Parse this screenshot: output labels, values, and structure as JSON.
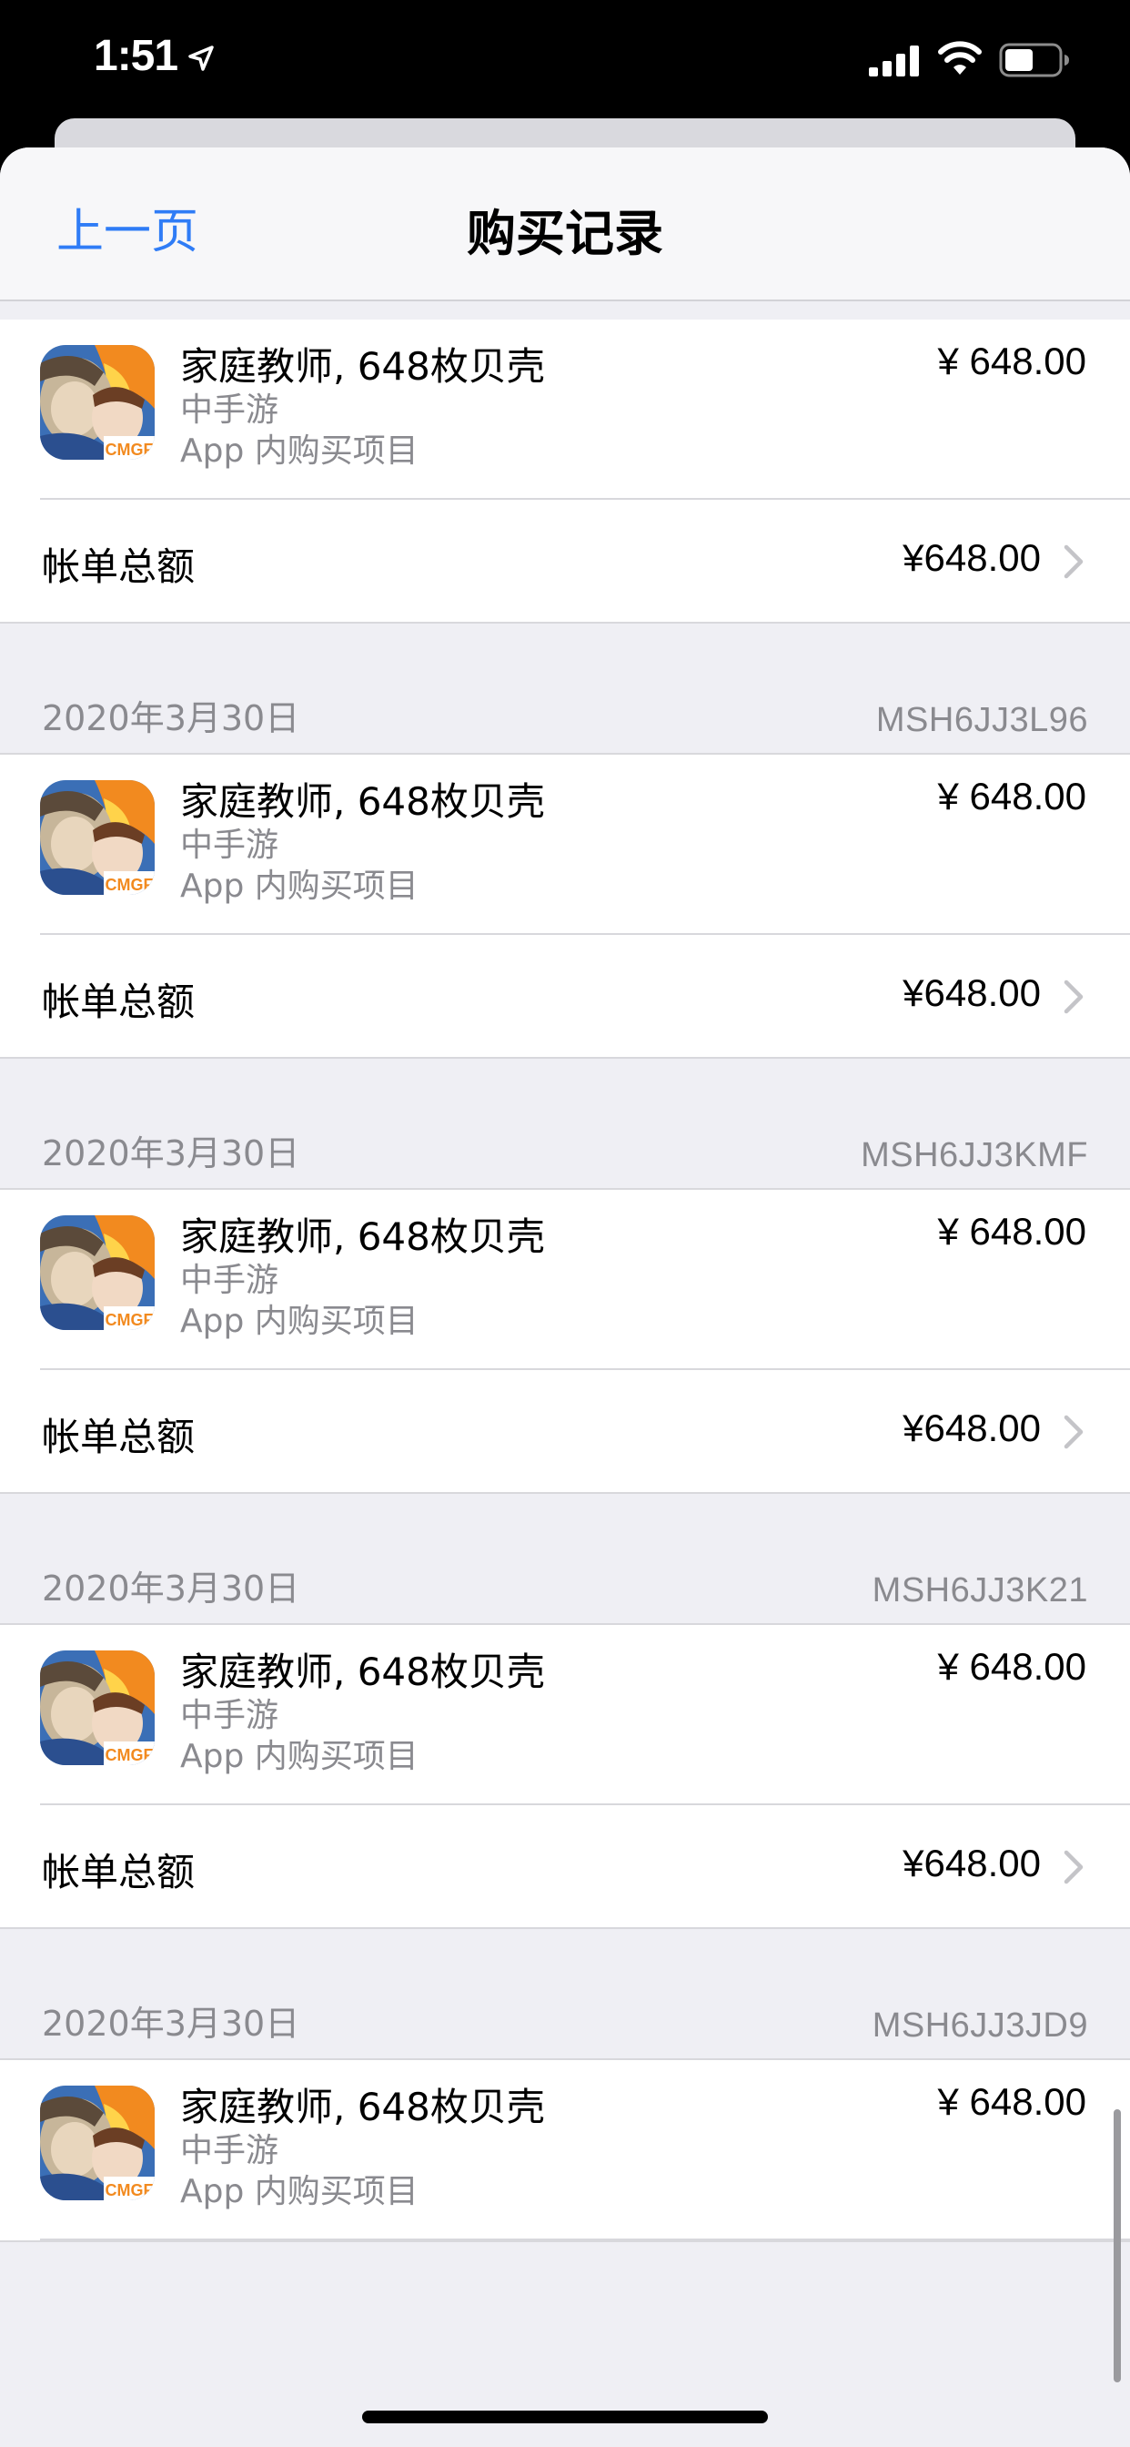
{
  "status_bar": {
    "time": "1:51"
  },
  "nav": {
    "back": "上一页",
    "title": "购买记录"
  },
  "colors": {
    "accent": "#2f7cf6",
    "secondary_text": "#8a8a8f",
    "background": "#efeff4"
  },
  "purchases": [
    {
      "date": "",
      "order_id": "",
      "item": {
        "title": "家庭教师, 648枚贝壳",
        "seller": "中手游",
        "type": "App 内购买项目",
        "price": "¥ 648.00",
        "icon": "app-icon-jiating-jiaoshi"
      },
      "total_label": "帐单总额",
      "total_value": "¥648.00"
    },
    {
      "date": "2020年3月30日",
      "order_id": "MSH6JJ3L96",
      "item": {
        "title": "家庭教师, 648枚贝壳",
        "seller": "中手游",
        "type": "App 内购买项目",
        "price": "¥ 648.00",
        "icon": "app-icon-jiating-jiaoshi"
      },
      "total_label": "帐单总额",
      "total_value": "¥648.00"
    },
    {
      "date": "2020年3月30日",
      "order_id": "MSH6JJ3KMF",
      "item": {
        "title": "家庭教师, 648枚贝壳",
        "seller": "中手游",
        "type": "App 内购买项目",
        "price": "¥ 648.00",
        "icon": "app-icon-jiating-jiaoshi"
      },
      "total_label": "帐单总额",
      "total_value": "¥648.00"
    },
    {
      "date": "2020年3月30日",
      "order_id": "MSH6JJ3K21",
      "item": {
        "title": "家庭教师, 648枚贝壳",
        "seller": "中手游",
        "type": "App 内购买项目",
        "price": "¥ 648.00",
        "icon": "app-icon-jiating-jiaoshi"
      },
      "total_label": "帐单总额",
      "total_value": "¥648.00"
    },
    {
      "date": "2020年3月30日",
      "order_id": "MSH6JJ3JD9",
      "item": {
        "title": "家庭教师, 648枚贝壳",
        "seller": "中手游",
        "type": "App 内购买项目",
        "price": "¥ 648.00",
        "icon": "app-icon-jiating-jiaoshi"
      },
      "total_label": "",
      "total_value": ""
    }
  ]
}
